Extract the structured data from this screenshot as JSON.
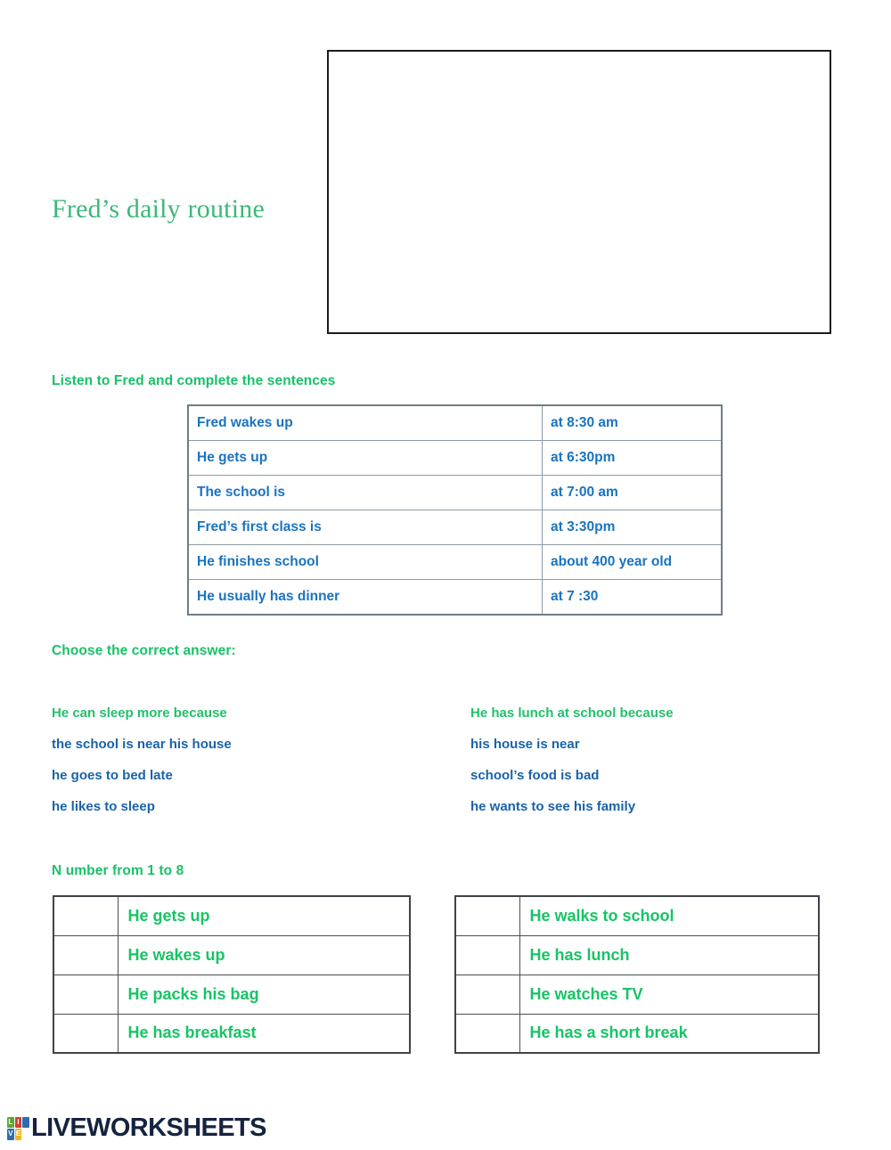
{
  "title": "Fred’s daily routine",
  "media": {
    "image_box_name": "embedded-image-placeholder"
  },
  "sections": {
    "listen_heading": "Listen to Fred and complete the sentences",
    "choose_heading": "Choose the correct answer:",
    "number_heading": "N umber from 1 to 8"
  },
  "sentences_table": {
    "rows": [
      {
        "prompt": "Fred wakes up",
        "answer": "at 8:30 am"
      },
      {
        "prompt": "He gets up",
        "answer": "at 6:30pm"
      },
      {
        "prompt": "The school is",
        "answer": "at 7:00 am"
      },
      {
        "prompt": "Fred’s first class is",
        "answer": "at 3:30pm"
      },
      {
        "prompt": "He finishes school",
        "answer": "about 400 year old"
      },
      {
        "prompt": "He usually has dinner",
        "answer": "at 7 :30"
      }
    ]
  },
  "multiple_choice": {
    "left": {
      "question": "He can sleep more because",
      "options": [
        "the school is near his house",
        "he goes to bed late",
        "he likes to sleep"
      ]
    },
    "right": {
      "question": "He has lunch at school because",
      "options": [
        "his house is near",
        "school’s food is bad",
        "he wants to see his family"
      ]
    }
  },
  "ordering": {
    "left_items": [
      "He gets up",
      "He wakes up",
      "He packs his bag",
      "He has breakfast"
    ],
    "right_items": [
      "He walks to school",
      "He has lunch",
      "He watches TV",
      "He has a short break"
    ]
  },
  "footer": {
    "wordmark": "LIVEWORKSHEETS",
    "logo_letters": [
      "L",
      "I",
      "V",
      "E"
    ]
  },
  "colors": {
    "title_green": "#3cb878",
    "heading_green": "#18c268",
    "answer_green": "#17c465",
    "table_blue": "#1a73c0",
    "option_blue": "#1a63a8",
    "box_border": "#1c1c1c",
    "table_border": "#8d9aa3",
    "order_border": "#4a4f53",
    "wordmark_navy": "#15233f"
  }
}
